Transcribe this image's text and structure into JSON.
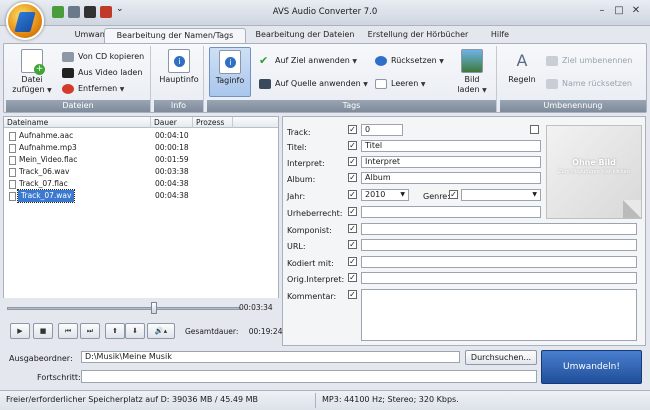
{
  "window": {
    "title": "AVS Audio Converter  7.0"
  },
  "tabs": [
    "Umwandlung",
    "Bearbeitung der Namen/Tags",
    "Bearbeitung der Dateien",
    "Erstellung der Hörbücher",
    "Hilfe"
  ],
  "ribbon": {
    "dateien": {
      "label": "Dateien",
      "datei_zufuegen": "Datei zufügen",
      "von_cd": "Von CD kopieren",
      "aus_video": "Aus Video laden",
      "entfernen": "Entfernen"
    },
    "info": {
      "label": "Info",
      "hauptinfo": "Hauptinfo"
    },
    "tags": {
      "label": "Tags",
      "taginfo": "Taginfo",
      "auf_ziel": "Auf Ziel anwenden",
      "auf_quelle": "Auf Quelle anwenden",
      "ruecksetzen": "Rücksetzen",
      "leeren": "Leeren",
      "bild_laden": "Bild laden"
    },
    "umbenennung": {
      "label": "Umbenennung",
      "regeln": "Regeln",
      "ziel_umbenennen": "Ziel umbenennen",
      "name_ruecksetzen": "Name rücksetzen"
    }
  },
  "filelist": {
    "columns": [
      "Dateiname",
      "Dauer",
      "Prozess"
    ],
    "rows": [
      {
        "name": "Aufnahme.aac",
        "duration": "00:04:10"
      },
      {
        "name": "Aufnahme.mp3",
        "duration": "00:00:18"
      },
      {
        "name": "Mein_Video.flac",
        "duration": "00:01:59"
      },
      {
        "name": "Track_06.wav",
        "duration": "00:03:38"
      },
      {
        "name": "Track_07.flac",
        "duration": "00:04:38"
      },
      {
        "name": "Track_07.wav",
        "duration": "00:04:38"
      }
    ],
    "selected_index": 5
  },
  "player": {
    "position": "00:03:34",
    "position_fraction": 0.63,
    "gesamtdauer_label": "Gesamtdauer:",
    "gesamtdauer": "00:19:24"
  },
  "tags": {
    "track_label": "Track:",
    "track": "0",
    "titel_label": "Titel:",
    "titel": "Titel",
    "interpret_label": "Interpret:",
    "interpret": "Interpret",
    "album_label": "Album:",
    "album": "Album",
    "jahr_label": "Jahr:",
    "jahr": "2010",
    "genre_label": "Genre:",
    "urheberrecht_label": "Urheberrecht:",
    "komponist_label": "Komponist:",
    "url_label": "URL:",
    "kodiert_label": "Kodiert mit:",
    "orig_label": "Orig.Interpret:",
    "kommentar_label": "Kommentar:",
    "cover_title": "Ohne Bild",
    "cover_sub": "Zum Hinzufügen hier klicken"
  },
  "output": {
    "ausgabeordner_label": "Ausgabeordner:",
    "ausgabeordner": "D:\\Musik\\Meine Musik",
    "durchsuchen": "Durchsuchen...",
    "fortschritt_label": "Fortschritt:",
    "umwandeln": "Umwandeln!"
  },
  "status": {
    "left": "Freier/erforderlicher Speicherplatz auf D: 39036 MB / 45.49 MB",
    "right": "MP3: 44100  Hz; Stereo; 320 Kbps."
  },
  "colors": {
    "accent": "#3b78d0",
    "convert_button": "#1f4f9a"
  }
}
